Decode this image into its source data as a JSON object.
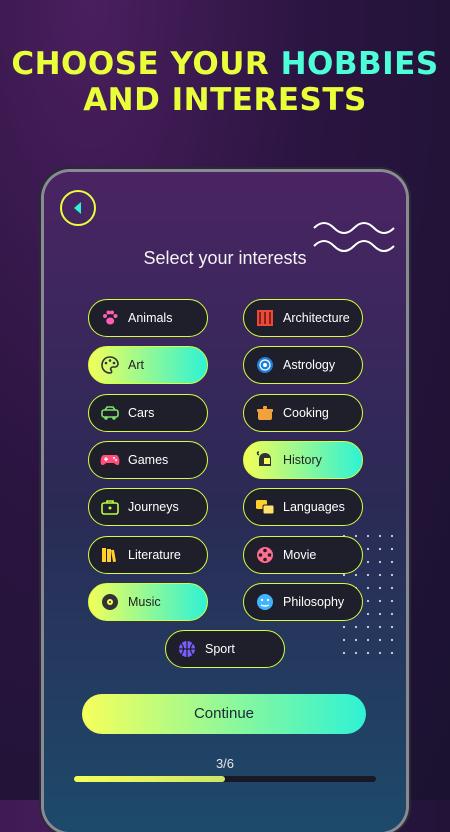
{
  "headline": {
    "line1_a": "CHOOSE YOUR ",
    "line1_b": "HOBBIES",
    "line2": "AND INTERESTS"
  },
  "screen": {
    "subtitle": "Select your interests",
    "interests": [
      {
        "label": "Animals",
        "icon": "paw-icon",
        "selected": false
      },
      {
        "label": "Architecture",
        "icon": "building-icon",
        "selected": false
      },
      {
        "label": "Art",
        "icon": "palette-icon",
        "selected": true
      },
      {
        "label": "Astrology",
        "icon": "zodiac-icon",
        "selected": false
      },
      {
        "label": "Cars",
        "icon": "car-icon",
        "selected": false
      },
      {
        "label": "Cooking",
        "icon": "pot-icon",
        "selected": false
      },
      {
        "label": "Games",
        "icon": "gamepad-icon",
        "selected": false
      },
      {
        "label": "History",
        "icon": "helmet-icon",
        "selected": true
      },
      {
        "label": "Journeys",
        "icon": "suitcase-icon",
        "selected": false
      },
      {
        "label": "Languages",
        "icon": "translate-icon",
        "selected": false
      },
      {
        "label": "Literature",
        "icon": "books-icon",
        "selected": false
      },
      {
        "label": "Movie",
        "icon": "film-reel-icon",
        "selected": false
      },
      {
        "label": "Music",
        "icon": "vinyl-icon",
        "selected": true
      },
      {
        "label": "Philosophy",
        "icon": "thinker-icon",
        "selected": false
      },
      {
        "label": "Sport",
        "icon": "basketball-icon",
        "selected": false
      }
    ],
    "continue_label": "Continue",
    "step": "3/6",
    "progress": 0.5
  },
  "colors": {
    "accent": "#e8ff3a",
    "accent2": "#4dffd8"
  }
}
